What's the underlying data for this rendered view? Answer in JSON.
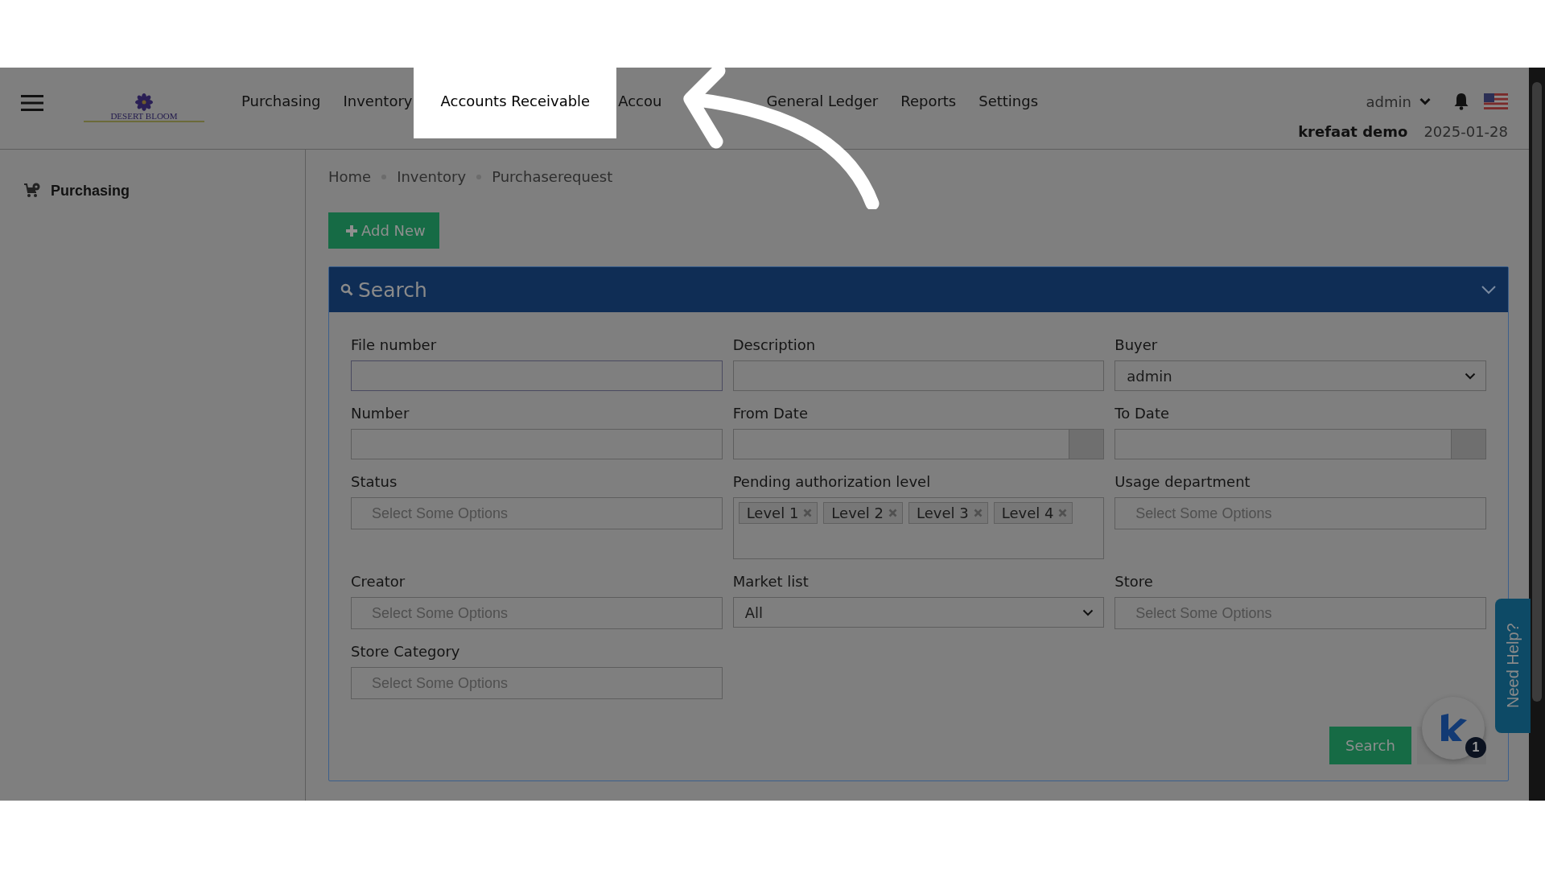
{
  "header": {
    "logo_text": "DESERT BLOOM",
    "nav": [
      {
        "label": "Purchasing",
        "highlighted": false
      },
      {
        "label": "Inventory",
        "highlighted": false
      },
      {
        "label": "Accounts Receivable",
        "highlighted": true
      },
      {
        "label": "Accou",
        "highlighted": false
      },
      {
        "label": "General Ledger",
        "highlighted": false
      },
      {
        "label": "Reports",
        "highlighted": false
      },
      {
        "label": "Settings",
        "highlighted": false
      }
    ],
    "user": "admin",
    "company": "krefaat demo",
    "date": "2025-01-28"
  },
  "sidebar": {
    "items": [
      {
        "label": "Purchasing"
      }
    ]
  },
  "breadcrumb": [
    "Home",
    "Inventory",
    "Purchaserequest"
  ],
  "add_button": "Add New",
  "search_panel": {
    "title": "Search",
    "fields": [
      {
        "label": "File number",
        "kind": "text"
      },
      {
        "label": "Description",
        "kind": "text"
      },
      {
        "label": "Buyer",
        "kind": "select",
        "value": "admin"
      },
      {
        "label": "Number",
        "kind": "text"
      },
      {
        "label": "From Date",
        "kind": "date"
      },
      {
        "label": "To Date",
        "kind": "date"
      },
      {
        "label": "Status",
        "kind": "multiselect",
        "placeholder": "Select Some Options"
      },
      {
        "label": "Pending authorization level",
        "kind": "multiselect",
        "tags": [
          "Level 1",
          "Level 2",
          "Level 3",
          "Level 4"
        ]
      },
      {
        "label": "Usage department",
        "kind": "multiselect",
        "placeholder": "Select Some Options"
      },
      {
        "label": "Creator",
        "kind": "multiselect",
        "placeholder": "Select Some Options"
      },
      {
        "label": "Market list",
        "kind": "select",
        "value": "All"
      },
      {
        "label": "Store",
        "kind": "multiselect",
        "placeholder": "Select Some Options"
      },
      {
        "label": "Store Category",
        "kind": "multiselect",
        "placeholder": "Select Some Options"
      }
    ],
    "search_button": "Search"
  },
  "help_tab": "Need Help?",
  "chat_badge": "1"
}
